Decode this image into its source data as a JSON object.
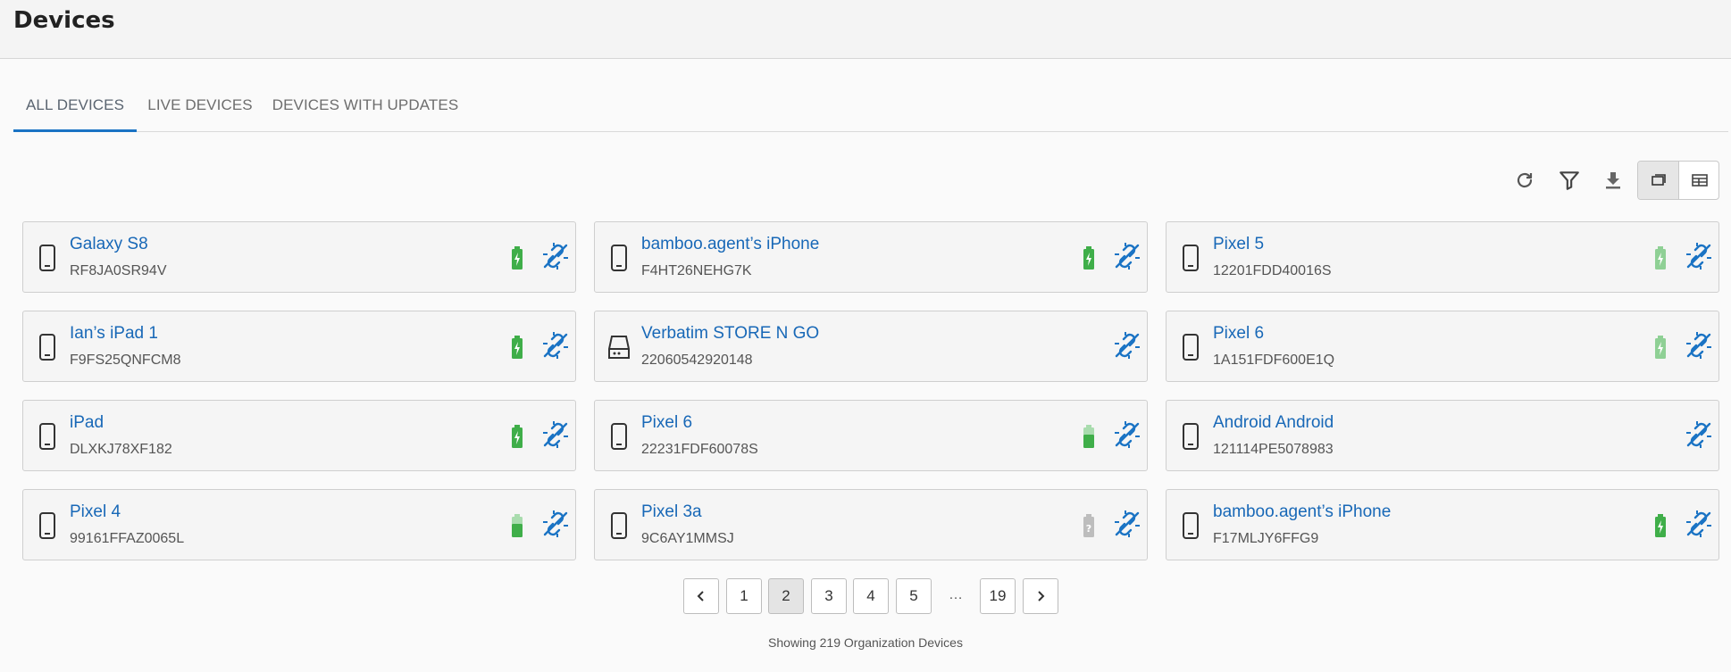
{
  "page": {
    "title": "Devices"
  },
  "tabs": [
    {
      "label": "ALL DEVICES",
      "active": true
    },
    {
      "label": "LIVE DEVICES",
      "active": false
    },
    {
      "label": "DEVICES WITH UPDATES",
      "active": false
    }
  ],
  "toolbar": {
    "icons": [
      "refresh-icon",
      "filter-icon",
      "download-icon"
    ],
    "view_modes": [
      "card-view-icon",
      "table-view-icon"
    ],
    "active_view": "card-view-icon"
  },
  "devices": [
    {
      "name": "Galaxy S8",
      "serial": "RF8JA0SR94V",
      "type": "phone",
      "battery": "charging-green"
    },
    {
      "name": "bamboo.agent’s iPhone",
      "serial": "F4HT26NEHG7K",
      "type": "phone",
      "battery": "charging-green"
    },
    {
      "name": "Pixel 5",
      "serial": "12201FDD40016S",
      "type": "phone",
      "battery": "charging-light"
    },
    {
      "name": "Ian’s iPad 1",
      "serial": "F9FS25QNFCM8",
      "type": "phone",
      "battery": "charging-green"
    },
    {
      "name": "Verbatim STORE N GO",
      "serial": "22060542920148",
      "type": "drive",
      "battery": "none"
    },
    {
      "name": "Pixel 6",
      "serial": "1A151FDF600E1Q",
      "type": "phone",
      "battery": "charging-light"
    },
    {
      "name": "iPad",
      "serial": "DLXKJ78XF182",
      "type": "phone",
      "battery": "charging-green"
    },
    {
      "name": "Pixel 6",
      "serial": "22231FDF60078S",
      "type": "phone",
      "battery": "partial-green"
    },
    {
      "name": "Android Android",
      "serial": "121114PE5078983",
      "type": "phone",
      "battery": "none"
    },
    {
      "name": "Pixel 4",
      "serial": "99161FFAZ0065L",
      "type": "phone",
      "battery": "partial-green"
    },
    {
      "name": "Pixel 3a",
      "serial": "9C6AY1MMSJ",
      "type": "phone",
      "battery": "unknown-grey"
    },
    {
      "name": "bamboo.agent’s iPhone",
      "serial": "F17MLJY6FFG9",
      "type": "phone",
      "battery": "charging-green"
    }
  ],
  "pagination": {
    "pages": [
      "1",
      "2",
      "3",
      "4",
      "5",
      "…",
      "19"
    ],
    "current": "2"
  },
  "footer": {
    "count_text": "Showing 219 Organization Devices"
  },
  "colors": {
    "accent": "#1a73c4",
    "link": "#1868b7",
    "battery_green": "#3fae49",
    "battery_light": "#8fd095",
    "battery_grey": "#bdbdbd"
  }
}
